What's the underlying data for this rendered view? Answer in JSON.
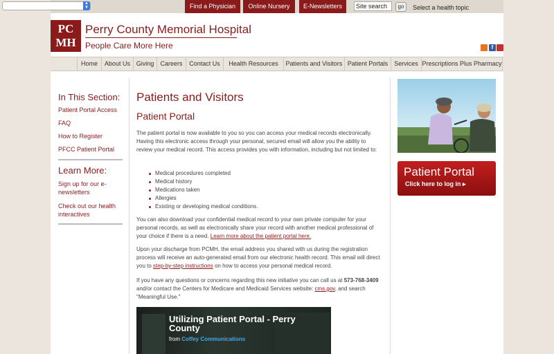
{
  "topbar": {
    "find_physician": "Find a Physician",
    "online_nursery": "Online Nursery",
    "enewsletters": "E-Newsletters",
    "search_value": "Site search",
    "go_label": "go",
    "health_topic": "Select a health topic"
  },
  "header": {
    "logo_text_1": "PC",
    "logo_text_2": "MH",
    "name": "Perry County Memorial Hospital",
    "tagline": "People Care More Here",
    "facebook_glyph": "f"
  },
  "nav": [
    "Home",
    "About Us",
    "Giving",
    "Careers",
    "Contact Us",
    "Health Resources",
    "Patients and Visitors",
    "Patient Portals",
    "Services",
    "Prescriptions Plus Pharmacy"
  ],
  "sidebar": {
    "section_heading": "In This Section:",
    "section_links": [
      "Patient Portal Access",
      "FAQ",
      "How to Register",
      "PFCC Patient Portal"
    ],
    "learn_heading": "Learn More:",
    "learn_links": [
      "Sign up for our e-newsletters",
      "Check out our health interactives"
    ]
  },
  "main": {
    "title": "Patients and Visitors",
    "subtitle": "Patient Portal",
    "p1": "The patient portal is now available to you so you can access your medical records electronically. Having this electronic access through your personal, secured email will allow you the ability to review your medical record. This access provides you with information, including but not limited to:",
    "bullets": [
      "Medical procedures completed",
      "Medical history",
      "Medications taken",
      "Allergies",
      "Existing or developing medical conditions."
    ],
    "p2_text": "You can also download your confidential medical record to your own private computer for your personal records, as well as electronically share your record with another medical professional of your choice if there is a need.",
    "p2_link": "Learn more about the patient portal here.",
    "p3_text": "Upon your discharge from PCMH, the email address you shared with us during the registration process will receive an auto-generated email from our electronic health record. This email will direct you to",
    "p3_link": "step-by-step instructions",
    "p3_tail": "on how to access your personal medical record.",
    "p4_text": "If you have any questions or concerns regarding this new initiative you can call us at",
    "p4_phone": "573-768-3409",
    "p4_mid": "and/or contact the Centers for Medicare and Medicaid Services website:",
    "p4_link": "cms.gov",
    "p4_tail": ", and search \"Meaningful Use.\"",
    "video_title": "Utilizing Patient Portal - Perry County",
    "video_from": "from",
    "video_author": "Coffey Communications"
  },
  "portal_button": {
    "title": "Patient Portal",
    "cta": "Click here to log in ▸"
  }
}
